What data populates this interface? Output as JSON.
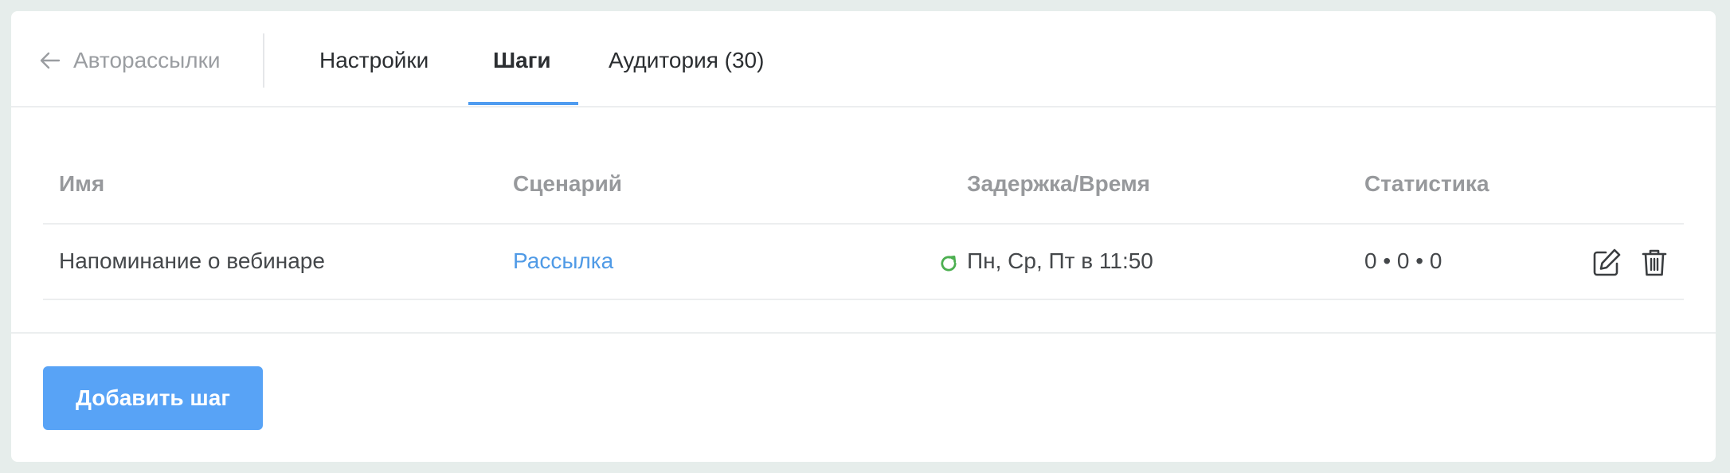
{
  "header": {
    "back_label": "Авторассылки",
    "tabs": [
      {
        "label": "Настройки",
        "active": false
      },
      {
        "label": "Шаги",
        "active": true
      },
      {
        "label": "Аудитория (30)",
        "active": false
      }
    ]
  },
  "table": {
    "columns": [
      "Имя",
      "Сценарий",
      "Задержка/Время",
      "Статистика"
    ],
    "rows": [
      {
        "name": "Напоминание о вебинаре",
        "scenario": "Рассылка",
        "schedule": "Пн, Ср, Пт в 11:50",
        "schedule_icon": "repeat-icon",
        "stats": "0 • 0 • 0",
        "actions": [
          "edit-icon",
          "trash-icon"
        ]
      }
    ]
  },
  "footer": {
    "add_button": "Добавить шаг"
  },
  "colors": {
    "accent": "#4f9cf0",
    "button": "#58a3f6",
    "link": "#4f9ae6",
    "repeat_icon": "#4caf50",
    "background": "#e6edeb"
  }
}
